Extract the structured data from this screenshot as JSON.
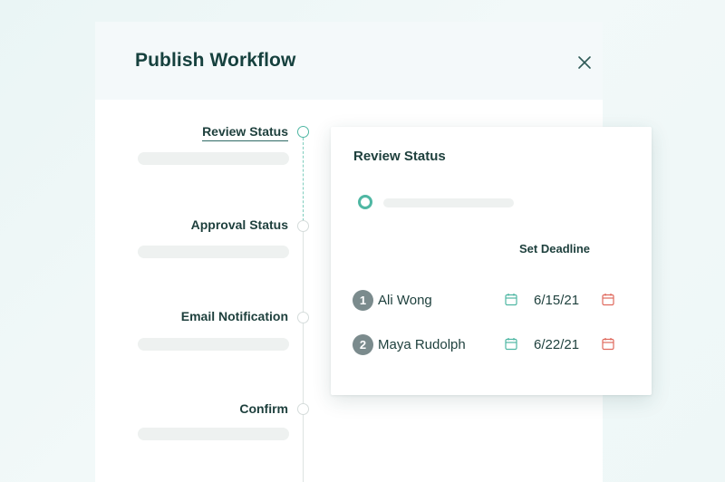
{
  "modal": {
    "title": "Publish Workflow",
    "close_icon": "close-icon"
  },
  "steps": [
    {
      "label": "Review Status",
      "active": true
    },
    {
      "label": "Approval Status",
      "active": false
    },
    {
      "label": "Email Notification",
      "active": false
    },
    {
      "label": "Confirm",
      "active": false
    }
  ],
  "popover": {
    "title": "Review Status",
    "deadline_label": "Set Deadline",
    "assignees": [
      {
        "number": "1",
        "name": "Ali Wong",
        "date": "6/15/21"
      },
      {
        "number": "2",
        "name": "Maya Rudolph",
        "date": "6/22/21"
      }
    ]
  },
  "colors": {
    "accent": "#4fb7a3",
    "title": "#16413e",
    "calendar_red": "#e06a5e",
    "badge": "#7b8b8d",
    "placeholder": "#eef1f0"
  }
}
